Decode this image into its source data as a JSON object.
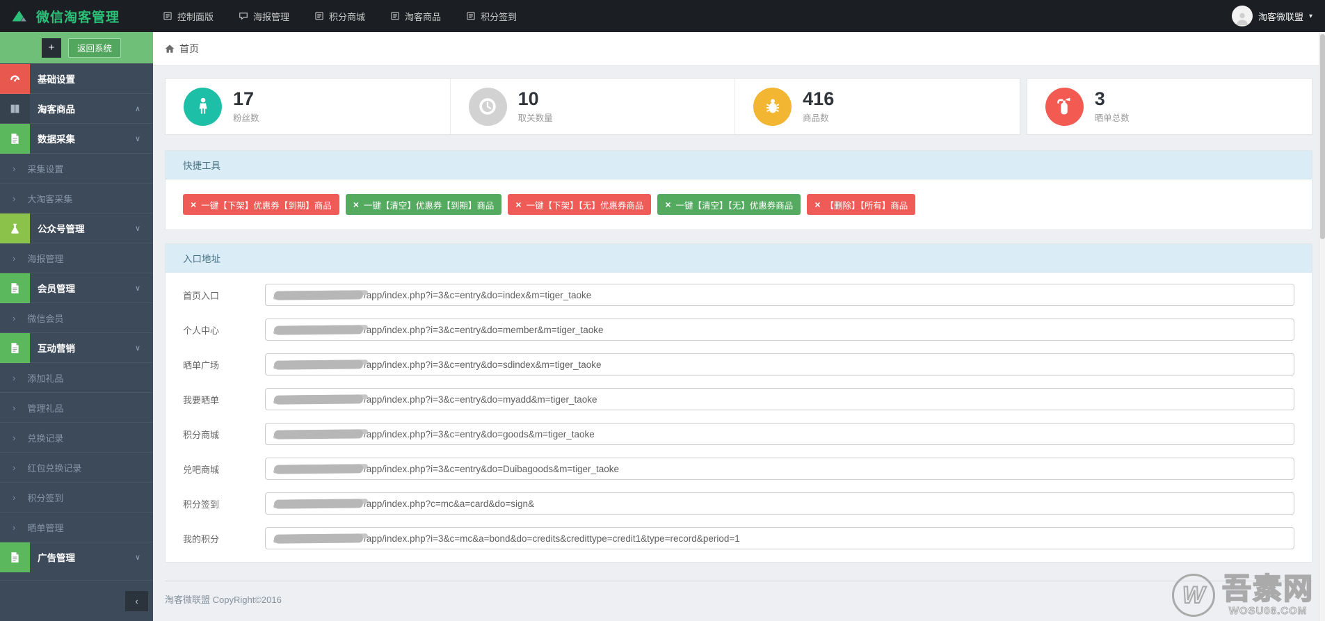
{
  "navbar": {
    "brand": "微信淘客管理",
    "menu": [
      {
        "label": "控制面版",
        "icon": "panel-icon"
      },
      {
        "label": "海报管理",
        "icon": "comment-icon"
      },
      {
        "label": "积分商城",
        "icon": "panel-icon"
      },
      {
        "label": "淘客商品",
        "icon": "panel-icon"
      },
      {
        "label": "积分签到",
        "icon": "panel-icon"
      }
    ],
    "user": {
      "name": "淘客微联盟"
    }
  },
  "sidebar": {
    "return_button": "返回系统",
    "items": [
      {
        "label": "基础设置",
        "type": "parent",
        "icon": "gauge-icon",
        "icon_bg": "#e8584f",
        "chevron": ""
      },
      {
        "label": "淘客商品",
        "type": "parent",
        "icon": "columns-icon",
        "icon_bg": "#37424f",
        "chevron": "up"
      },
      {
        "label": "数据采集",
        "type": "parent",
        "icon": "file-icon",
        "icon_bg": "#5cb85c",
        "chevron": "down"
      },
      {
        "label": "采集设置",
        "type": "sub"
      },
      {
        "label": "大淘客采集",
        "type": "sub"
      },
      {
        "label": "公众号管理",
        "type": "parent",
        "icon": "flask-icon",
        "icon_bg": "#8bc34a",
        "chevron": "down"
      },
      {
        "label": "海报管理",
        "type": "sub"
      },
      {
        "label": "会员管理",
        "type": "parent",
        "icon": "file-icon",
        "icon_bg": "#5cb85c",
        "chevron": "down"
      },
      {
        "label": "微信会员",
        "type": "sub"
      },
      {
        "label": "互动营销",
        "type": "parent",
        "icon": "file-icon",
        "icon_bg": "#5cb85c",
        "chevron": "down"
      },
      {
        "label": "添加礼品",
        "type": "sub"
      },
      {
        "label": "管理礼品",
        "type": "sub"
      },
      {
        "label": "兑换记录",
        "type": "sub"
      },
      {
        "label": "红包兑换记录",
        "type": "sub"
      },
      {
        "label": "积分签到",
        "type": "sub"
      },
      {
        "label": "晒单管理",
        "type": "sub"
      },
      {
        "label": "广告管理",
        "type": "parent",
        "icon": "file-icon",
        "icon_bg": "#5cb85c",
        "chevron": "down"
      }
    ]
  },
  "breadcrumb": {
    "home": "首页"
  },
  "stats": {
    "cards": [
      {
        "value": "17",
        "label": "粉丝数",
        "icon": "user-icon",
        "color": "#1dbfa7"
      },
      {
        "value": "10",
        "label": "取关数量",
        "icon": "clock-icon",
        "color": "#d2d2d2"
      },
      {
        "value": "416",
        "label": "商品数",
        "icon": "bug-icon",
        "color": "#f2b632"
      },
      {
        "value": "3",
        "label": "晒单总数",
        "icon": "extinguisher-icon",
        "color": "#f25a52"
      }
    ]
  },
  "quick_tools": {
    "title": "快捷工具",
    "buttons": [
      {
        "label": "一键【下架】优惠券【到期】商品",
        "color": "#ef5b56"
      },
      {
        "label": "一键【清空】优惠券【到期】商品",
        "color": "#54ab60"
      },
      {
        "label": "一键【下架】【无】优惠券商品",
        "color": "#ef5b56"
      },
      {
        "label": "一键【清空】【无】优惠券商品",
        "color": "#54ab60"
      },
      {
        "label": "【删除】【所有】商品",
        "color": "#ef5b56"
      }
    ]
  },
  "entry_panel": {
    "title": "入口地址",
    "fields": [
      {
        "label": "首页入口",
        "url_redacted_domain": true,
        "url": "/app/index.php?i=3&c=entry&do=index&m=tiger_taoke"
      },
      {
        "label": "个人中心",
        "url_redacted_domain": true,
        "url": "/app/index.php?i=3&c=entry&do=member&m=tiger_taoke"
      },
      {
        "label": "晒单广场",
        "url_redacted_domain": true,
        "url": "/app/index.php?i=3&c=entry&do=sdindex&m=tiger_taoke"
      },
      {
        "label": "我要晒单",
        "url_redacted_domain": true,
        "url": "/app/index.php?i=3&c=entry&do=myadd&m=tiger_taoke"
      },
      {
        "label": "积分商城",
        "url_redacted_domain": true,
        "url": "/app/index.php?i=3&c=entry&do=goods&m=tiger_taoke"
      },
      {
        "label": "兑吧商城",
        "url_redacted_domain": true,
        "url": "/app/index.php?i=3&c=entry&do=Duibagoods&m=tiger_taoke"
      },
      {
        "label": "积分签到",
        "url_redacted_domain": true,
        "url": "/app/index.php?c=mc&a=card&do=sign&"
      },
      {
        "label": "我的积分",
        "url_redacted_domain": true,
        "url": "/app/index.php?i=3&c=mc&a=bond&do=credits&credittype=credit1&type=record&period=1"
      }
    ]
  },
  "footer": {
    "copyright": "淘客微联盟 CopyRight©2016"
  },
  "watermark": {
    "letter": "W",
    "site_name": "吾素网",
    "site_url": "WOSU08.COM"
  }
}
